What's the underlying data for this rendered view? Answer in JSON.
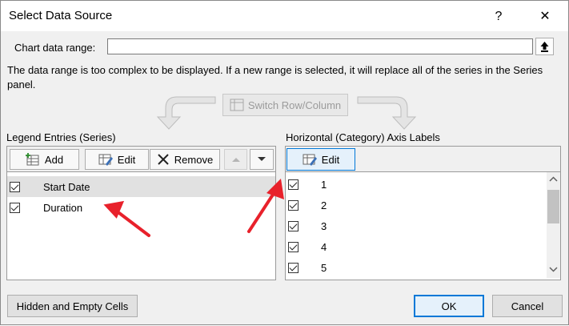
{
  "title": "Select Data Source",
  "title_buttons": {
    "help": "?",
    "close": "✕"
  },
  "chart_range": {
    "label": "Chart data range:",
    "value": ""
  },
  "note": "The data range is too complex to be displayed. If a new range is selected, it will replace all of the series in the Series panel.",
  "switch_button": "Switch Row/Column",
  "legend": {
    "label": "Legend Entries (Series)",
    "add": "Add",
    "edit": "Edit",
    "remove": "Remove",
    "items": [
      {
        "label": "Start Date",
        "checked": true,
        "selected": true
      },
      {
        "label": "Duration",
        "checked": true,
        "selected": false
      }
    ]
  },
  "axis": {
    "label": "Horizontal (Category) Axis Labels",
    "edit": "Edit",
    "items": [
      {
        "label": "1",
        "checked": true
      },
      {
        "label": "2",
        "checked": true
      },
      {
        "label": "3",
        "checked": true
      },
      {
        "label": "4",
        "checked": true
      },
      {
        "label": "5",
        "checked": true
      }
    ]
  },
  "footer": {
    "hidden_cells": "Hidden and Empty Cells",
    "ok": "OK",
    "cancel": "Cancel"
  },
  "colors": {
    "accent": "#0078d7",
    "annotation_arrow": "#e8212b",
    "selected_row": "#e1e1e1"
  },
  "icons": [
    "upload-icon",
    "switch-row-column-icon",
    "add-series-icon",
    "edit-series-icon",
    "remove-x-icon",
    "move-up-icon",
    "move-down-icon",
    "edit-axis-icon",
    "scroll-up-icon",
    "scroll-down-icon"
  ]
}
